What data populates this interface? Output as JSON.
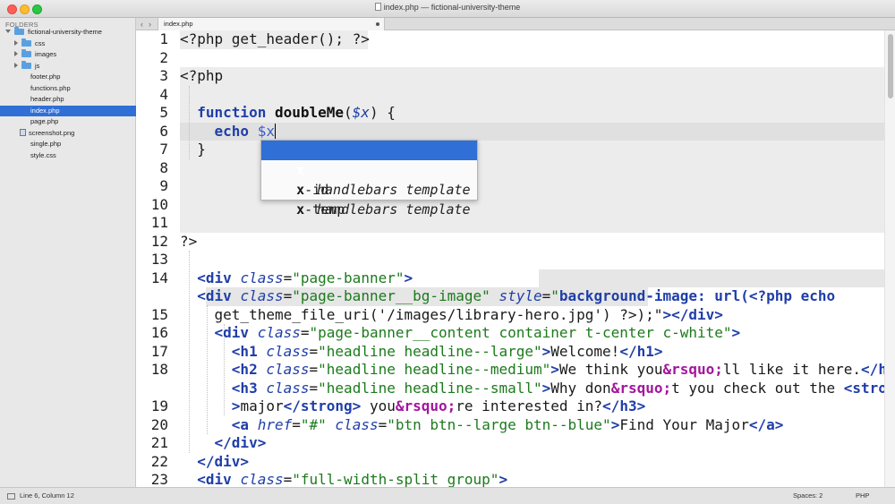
{
  "window": {
    "title": "index.php — fictional-university-theme"
  },
  "sidebar": {
    "header": "FOLDERS",
    "root": "fictional-university-theme",
    "folders": [
      "css",
      "images",
      "js"
    ],
    "files": [
      "footer.php",
      "functions.php",
      "header.php",
      "index.php",
      "page.php",
      "screenshot.png",
      "single.php",
      "style.css"
    ],
    "selected_file": "index.php"
  },
  "tabs": {
    "nav_back": "‹",
    "nav_forward": "›",
    "active_tab": "index.php"
  },
  "editor": {
    "line_numbers": [
      "1",
      "2",
      "3",
      "4",
      "5",
      "6",
      "7",
      "8",
      "9",
      "10",
      "11",
      "12",
      "13",
      "14",
      "",
      "15",
      "16",
      "17",
      "18",
      "",
      "19",
      "20",
      "21",
      "22",
      "23"
    ],
    "lines": {
      "l1": "<?php get_header(); ?>",
      "l3": "<?php",
      "l5_kw": "function",
      "l5_fn": "doubleMe",
      "l5_var": "$x",
      "l6_kw": "echo",
      "l6_var": "$x",
      "l11": "?>",
      "l13_class_val": "\"page-banner\"",
      "l14_class_val": "\"page-banner__bg-image\"",
      "l14_style_val": "background-image: url(<?php echo",
      "l14b": "get_theme_file_uri('/images/library-hero.jpg') ?>);\"",
      "l15_class_val": "\"page-banner__content container t-center c-white\"",
      "l16_class_val": "\"headline headline--large\"",
      "l16_text": "Welcome!",
      "l17_class_val": "\"headline headline--medium\"",
      "l17_text_a": "We think you",
      "l17_text_b": "ll like it here.",
      "l18_class_val": "\"headline headline--small\"",
      "l18_text_a": "Why don",
      "l18_text_b": "t you check out the ",
      "l18b_text_a": "major",
      "l18b_text_b": " you",
      "l18b_text_c": "re interested in?",
      "l19_href_val": "\"#\"",
      "l19_class_val": "\"btn btn--large btn--blue\"",
      "l19_text": "Find Your Major",
      "l23_class_val": "\"full-width-split group\""
    }
  },
  "autocomplete": {
    "items": [
      {
        "match": "x",
        "rest": "",
        "hint": ""
      },
      {
        "match": "x",
        "rest": "-id",
        "hint": "handlebars template"
      },
      {
        "match": "x",
        "rest": "-temp",
        "hint": "handlebars template"
      }
    ]
  },
  "statusbar": {
    "position": "Line 6, Column 12",
    "spaces": "Spaces: 2",
    "syntax": "PHP"
  }
}
